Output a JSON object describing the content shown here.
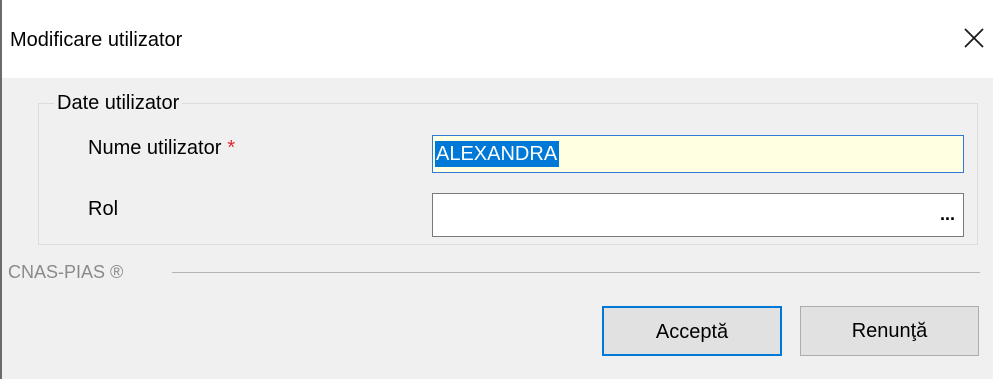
{
  "dialog": {
    "title": "Modificare utilizator"
  },
  "group": {
    "legend": "Date utilizator"
  },
  "fields": {
    "username_label": "Nume utilizator",
    "username_required_marker": "*",
    "username_value": "ALEXANDRA",
    "role_label": "Rol",
    "role_value": "",
    "role_browse_label": "..."
  },
  "footer": {
    "brand": "CNAS-PIAS ®"
  },
  "buttons": {
    "accept_label": "Acceptă",
    "cancel_label": "Renunţă"
  },
  "colors": {
    "client_background": "#f0f0f0",
    "selection": "#0078d7",
    "input_highlight": "#ffffe1",
    "required": "#e3262c",
    "brand_text": "#8a8a8a"
  },
  "icons": {
    "close": "close-icon"
  }
}
